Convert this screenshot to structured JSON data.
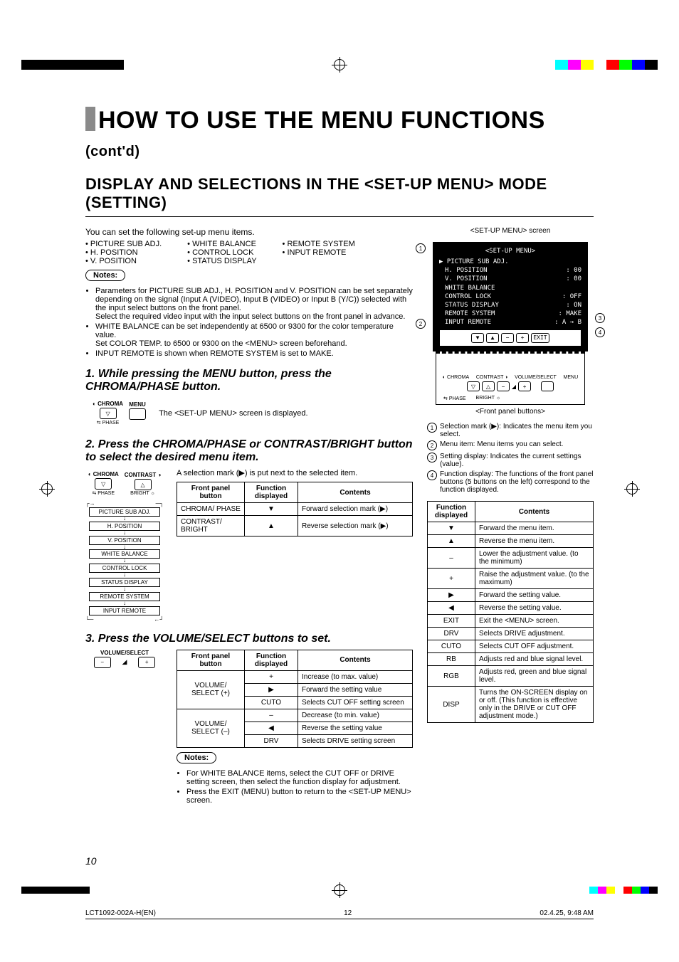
{
  "page_number": "10",
  "footer": {
    "doc_id": "LCT1092-002A-H(EN)",
    "page": "12",
    "timestamp": "02.4.25, 9:48 AM"
  },
  "title_main": "HOW TO USE THE MENU FUNCTIONS",
  "title_cont": "(cont'd)",
  "subtitle": "DISPLAY AND SELECTIONS IN THE <SET-UP MENU> MODE (SETTING)",
  "intro": "You can set the following set-up menu items.",
  "menu_items_cols": {
    "c1": [
      "• PICTURE SUB ADJ.",
      "• H. POSITION",
      "• V. POSITION"
    ],
    "c2": [
      "• WHITE BALANCE",
      "• CONTROL LOCK",
      "• STATUS DISPLAY"
    ],
    "c3": [
      "• REMOTE SYSTEM",
      "• INPUT REMOTE"
    ]
  },
  "notes_label": "Notes:",
  "notes1": [
    "Parameters for PICTURE SUB ADJ., H. POSITION and V. POSITION can be set separately depending on the signal (Input A (VIDEO), Input B (VIDEO) or Input B (Y/C)) selected with the input select buttons on the front panel.\nSelect the required video input with the input select buttons on the front panel in advance.",
    "WHITE BALANCE can be set independently at 6500 or 9300 for the color temperature value.\nSet COLOR TEMP. to 6500 or 9300 on the <MENU> screen beforehand.",
    "INPUT REMOTE is shown when REMOTE SYSTEM is set to MAKE."
  ],
  "step1": {
    "heading": "1. While pressing the MENU button, press the CHROMA/PHASE button.",
    "desc": "The <SET-UP MENU> screen is displayed.",
    "btn_left_top": "CHROMA",
    "btn_right_top": "MENU",
    "btn_left_sym": "▽",
    "btn_right_sym": " ",
    "btn_left_sub": "PHASE"
  },
  "step2": {
    "heading": "2. Press the CHROMA/PHASE or CONTRAST/BRIGHT button to select the desired menu item.",
    "desc": "A selection mark (▶) is put next to the selected item.",
    "btn_a_top": "CHROMA",
    "btn_b_top": "CONTRAST",
    "btn_a_sym": "▽",
    "btn_b_sym": "△",
    "btn_a_sub": "PHASE",
    "btn_b_sub": "BRIGHT",
    "flow": [
      "PICTURE SUB ADJ.",
      "H. POSITION",
      "V. POSITION",
      "WHITE BALANCE",
      "CONTROL LOCK",
      "STATUS DISPLAY",
      "REMOTE SYSTEM",
      "INPUT  REMOTE"
    ],
    "table_head": [
      "Front panel button",
      "Function displayed",
      "Contents"
    ],
    "rows": [
      [
        "CHROMA/ PHASE",
        "▼",
        "Forward selection mark (▶)"
      ],
      [
        "CONTRAST/ BRIGHT",
        "▲",
        "Reverse selection mark (▶)"
      ]
    ]
  },
  "step3": {
    "heading": "3. Press the VOLUME/SELECT buttons to set.",
    "btn_top": "VOLUME/SELECT",
    "btn_minus": "−",
    "btn_plus": "+",
    "table_head": [
      "Front panel button",
      "Function displayed",
      "Contents"
    ],
    "rows": [
      {
        "b": "VOLUME/ SELECT (+)",
        "f": "+",
        "c": "Increase (to max. value)"
      },
      {
        "b": "",
        "f": "▶",
        "c": "Forward the setting value"
      },
      {
        "b": "",
        "f": "CUTO",
        "c": "Selects CUT OFF setting screen"
      },
      {
        "b": "VOLUME/ SELECT (–)",
        "f": "–",
        "c": "Decrease (to min. value)"
      },
      {
        "b": "",
        "f": "◀",
        "c": "Reverse the setting value"
      },
      {
        "b": "",
        "f": "DRV",
        "c": "Selects DRIVE setting screen"
      }
    ],
    "notes": [
      "For WHITE BALANCE items, select the CUT OFF or DRIVE setting screen, then select the function display for adjustment.",
      "Press the EXIT (MENU) button to return to the <SET-UP MENU> screen."
    ]
  },
  "right": {
    "screen_caption_top": "<SET-UP MENU> screen",
    "screen": {
      "title": "<SET-UP MENU>",
      "rows": [
        [
          "▶ PICTURE SUB ADJ.",
          ""
        ],
        [
          "H. POSITION",
          ": 00"
        ],
        [
          "V. POSITION",
          ": 00"
        ],
        [
          "WHITE BALANCE",
          ""
        ],
        [
          "CONTROL LOCK",
          ": OFF"
        ],
        [
          "STATUS DISPLAY",
          ": ON"
        ],
        [
          "REMOTE SYSTEM",
          ": MAKE"
        ],
        [
          "INPUT REMOTE",
          ": A → B"
        ]
      ],
      "panel_btns": [
        "▼",
        "▲",
        "−",
        "+",
        "EXIT"
      ],
      "panel_labels_row1": [
        "CHROMA",
        "CONTRAST",
        "VOLUME/SELECT",
        "MENU"
      ],
      "panel_btns2": [
        "▽",
        "△",
        "−",
        "+",
        " "
      ],
      "panel_labels_row2": [
        "PHASE",
        "BRIGHT"
      ]
    },
    "screen_caption_bottom": "<Front panel buttons>",
    "annotations": [
      "Selection mark (▶): Indicates the menu item you select.",
      "Menu item: Menu items you can select.",
      "Setting display: Indicates the current settings (value).",
      "Function display: The functions of the front panel buttons (5 buttons on the left) correspond to the function displayed."
    ],
    "func_table_head": [
      "Function displayed",
      "Contents"
    ],
    "func_rows": [
      [
        "▼",
        "Forward the menu item."
      ],
      [
        "▲",
        "Reverse the menu item."
      ],
      [
        "–",
        "Lower the adjustment value. (to the minimum)"
      ],
      [
        "+",
        "Raise the adjustment value. (to the maximum)"
      ],
      [
        "▶",
        "Forward the setting value."
      ],
      [
        "◀",
        "Reverse the setting value."
      ],
      [
        "EXIT",
        "Exit the <MENU> screen."
      ],
      [
        "DRV",
        "Selects DRIVE adjustment."
      ],
      [
        "CUTO",
        "Selects CUT OFF adjustment."
      ],
      [
        "RB",
        "Adjusts red and blue signal level."
      ],
      [
        "RGB",
        "Adjusts red, green and blue signal level."
      ],
      [
        "DISP",
        "Turns the ON-SCREEN display on or off. (This function is effective only in the DRIVE or CUT OFF adjustment mode.)"
      ]
    ]
  }
}
